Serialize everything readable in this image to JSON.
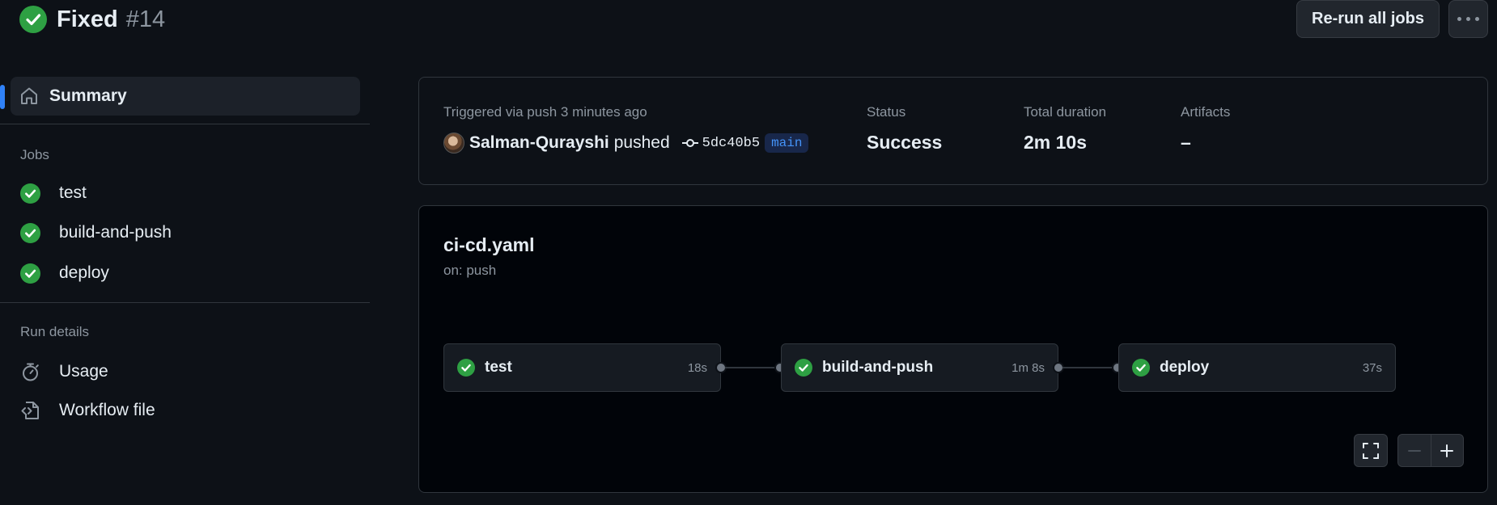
{
  "header": {
    "title": "Fixed",
    "run_number": "#14",
    "rerun_label": "Re-run all jobs",
    "more_icon": "kebab-horizontal-icon"
  },
  "sidebar": {
    "summary_label": "Summary",
    "jobs_heading": "Jobs",
    "jobs": [
      {
        "label": "test",
        "status": "success"
      },
      {
        "label": "build-and-push",
        "status": "success"
      },
      {
        "label": "deploy",
        "status": "success"
      }
    ],
    "run_details_heading": "Run details",
    "run_details": [
      {
        "label": "Usage",
        "icon": "stopwatch-icon"
      },
      {
        "label": "Workflow file",
        "icon": "file-code-icon"
      }
    ]
  },
  "summary": {
    "trigger": "Triggered via push 3 minutes ago",
    "author": "Salman-Qurayshi",
    "action": "pushed",
    "commit_sha": "5dc40b5",
    "branch": "main",
    "status_label": "Status",
    "status_value": "Success",
    "duration_label": "Total duration",
    "duration_value": "2m 10s",
    "artifacts_label": "Artifacts",
    "artifacts_value": "–"
  },
  "graph": {
    "workflow_file": "ci-cd.yaml",
    "trigger": "on: push",
    "jobs": [
      {
        "name": "test",
        "duration": "18s",
        "status": "success"
      },
      {
        "name": "build-and-push",
        "duration": "1m 8s",
        "status": "success"
      },
      {
        "name": "deploy",
        "duration": "37s",
        "status": "success"
      }
    ]
  },
  "colors": {
    "success": "#2ea043",
    "accent": "#2f81f7",
    "background": "#0d1117"
  }
}
